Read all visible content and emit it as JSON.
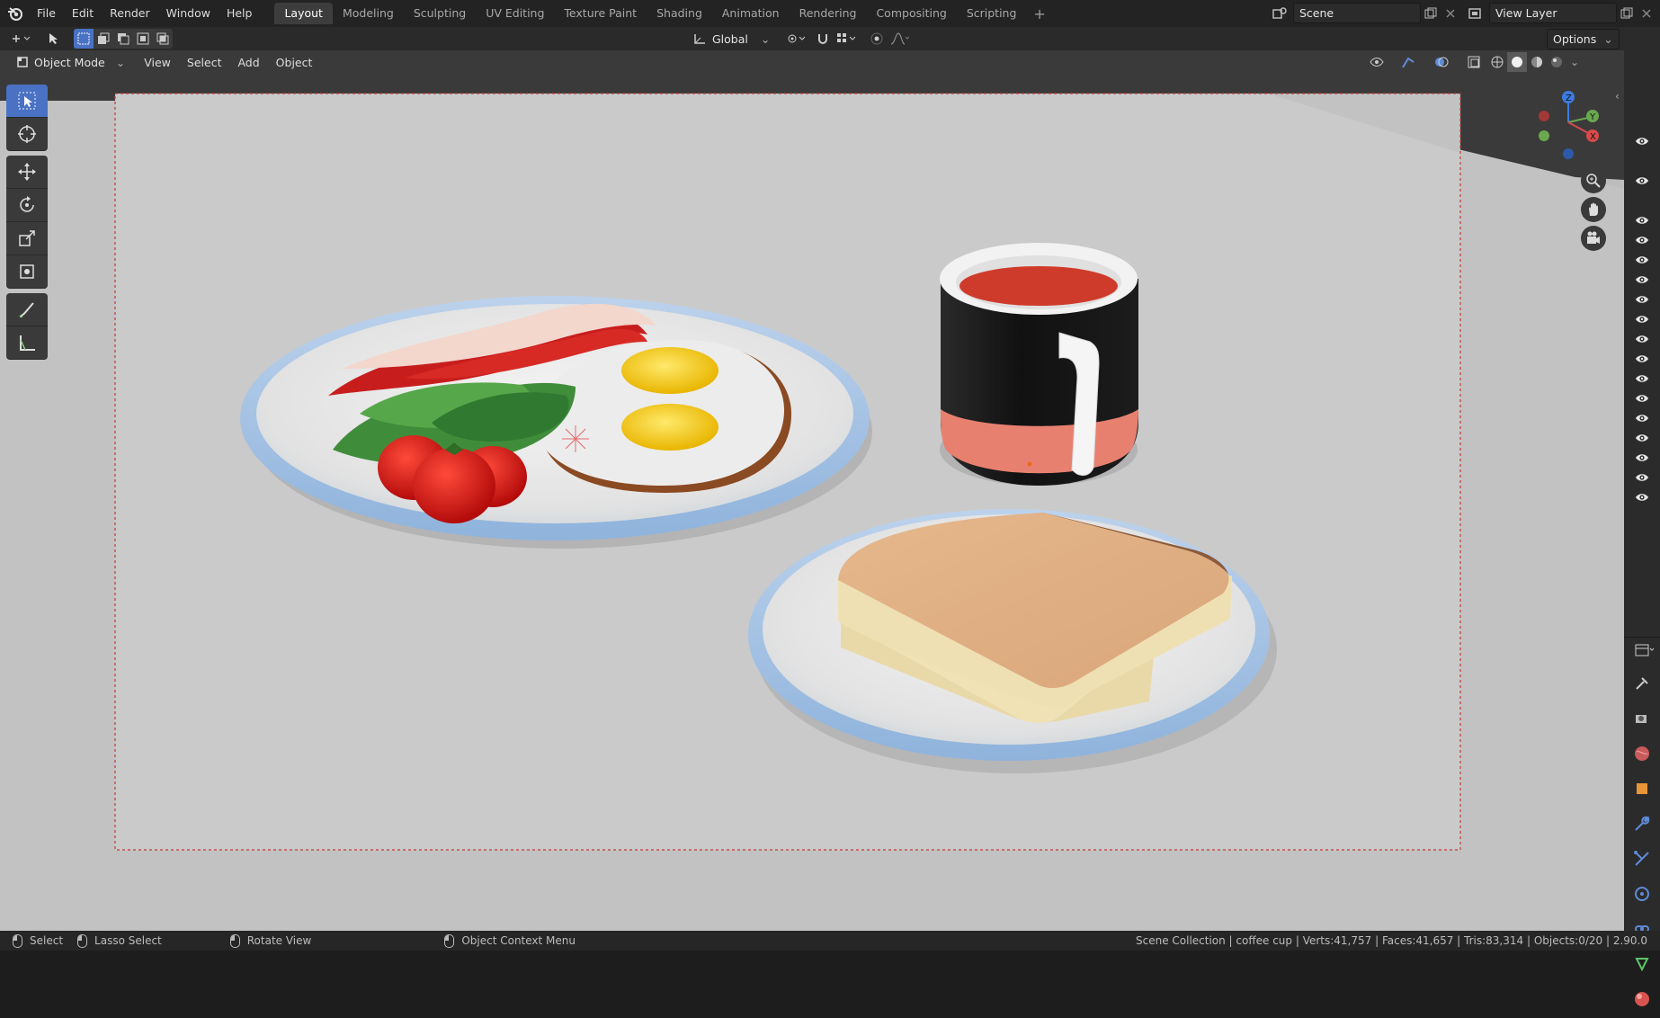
{
  "app": {
    "name": "Blender",
    "version": "2.90.0"
  },
  "menu": [
    "File",
    "Edit",
    "Render",
    "Window",
    "Help"
  ],
  "workspaces": [
    "Layout",
    "Modeling",
    "Sculpting",
    "UV Editing",
    "Texture Paint",
    "Shading",
    "Animation",
    "Rendering",
    "Compositing",
    "Scripting"
  ],
  "active_workspace": "Layout",
  "scene": {
    "name": "Scene"
  },
  "view_layer": {
    "name": "View Layer"
  },
  "transform": {
    "orientation": "Global"
  },
  "options_label": "Options",
  "header": {
    "mode": "Object Mode",
    "menus": [
      "View",
      "Select",
      "Add",
      "Object"
    ]
  },
  "tools": [
    "select-box",
    "cursor",
    "move",
    "rotate",
    "scale",
    "transform",
    "annotate",
    "measure"
  ],
  "outliner": {
    "visible_rows": 17
  },
  "scene_objects": {
    "plate_1": [
      "bacon",
      "lettuce",
      "tomatoes",
      "fried eggs"
    ],
    "plate_2": [
      "toast"
    ],
    "mug": "coffee cup"
  },
  "colors": {
    "accent": "#4a72c4",
    "bg_dark": "#1d1d1d",
    "viewport": "#bdbdbd",
    "camera_border": "#c43a3a"
  },
  "statusbar": {
    "select": "Select",
    "lasso": "Lasso Select",
    "rotate": "Rotate View",
    "context": "Object Context Menu",
    "stats": "Scene Collection | coffee cup | Verts:41,757 | Faces:41,657 | Tris:83,314 | Objects:0/20 | 2.90.0"
  }
}
